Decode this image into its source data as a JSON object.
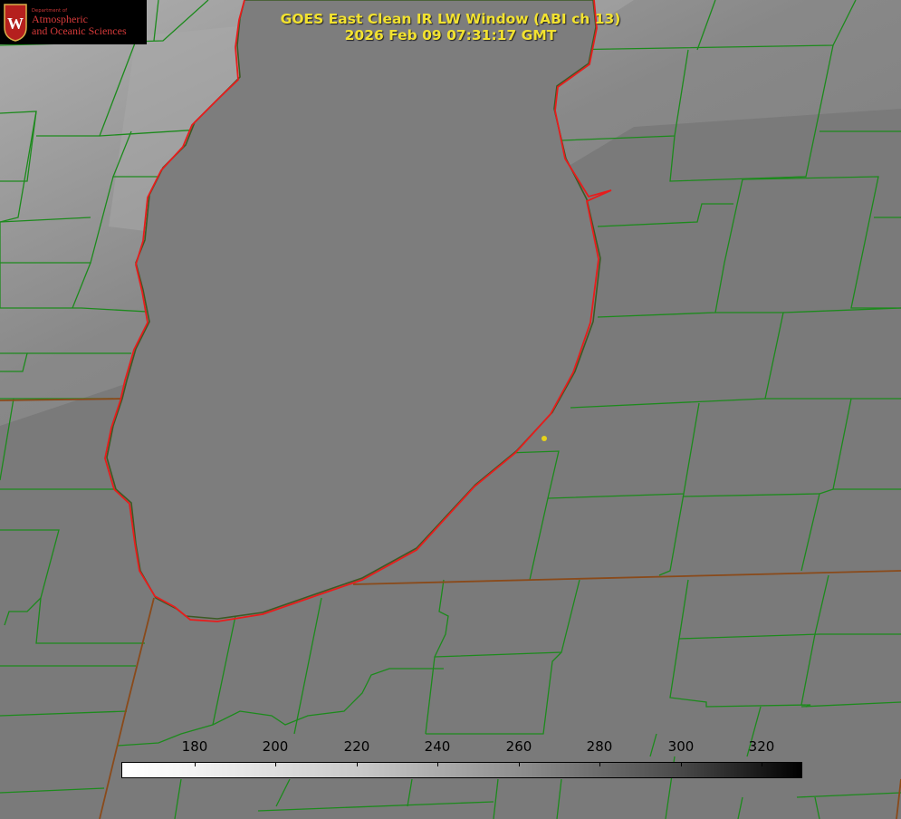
{
  "logo": {
    "department": "Department of",
    "line1": "Atmospheric",
    "line2": "and Oceanic Sciences",
    "seal_letter": "W",
    "brand_color": "#d63a3a"
  },
  "title": {
    "line1": "GOES East Clean IR LW Window (ABI ch 13)",
    "line2": "2026 Feb 09 07:31:17 GMT",
    "color": "#f2e230"
  },
  "colorbar": {
    "ticks": [
      "180",
      "200",
      "220",
      "240",
      "260",
      "280",
      "300",
      "320"
    ]
  },
  "colors": {
    "county_lines": "#1c8a1c",
    "state_lines": "#8a4a1a",
    "lake_outline": "#e81c1c",
    "marker": "#e6d21a"
  }
}
